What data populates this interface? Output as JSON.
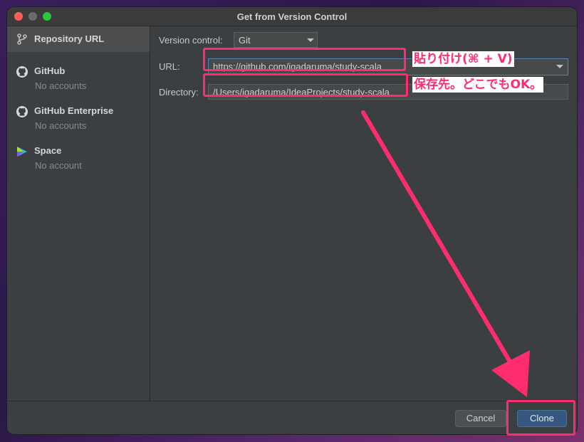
{
  "window": {
    "title": "Get from Version Control"
  },
  "sidebar": {
    "items": [
      {
        "label": "Repository URL",
        "icon": "vcs-branch-icon"
      },
      {
        "label": "GitHub",
        "sub": "No accounts",
        "icon": "github-icon"
      },
      {
        "label": "GitHub Enterprise",
        "sub": "No accounts",
        "icon": "github-icon"
      },
      {
        "label": "Space",
        "sub": "No account",
        "icon": "space-icon"
      }
    ]
  },
  "form": {
    "version_control_label": "Version control:",
    "version_control_value": "Git",
    "url_label": "URL:",
    "url_value": "https://github.com/igadaruma/study-scala",
    "directory_label": "Directory:",
    "directory_value": "/Users/igadaruma/IdeaProjects/study-scala"
  },
  "annotations": {
    "url_note": "貼り付け(⌘ + V)",
    "directory_note": "保存先。どこでもOK。"
  },
  "buttons": {
    "cancel": "Cancel",
    "clone": "Clone"
  },
  "colors": {
    "highlight": "#ff2d6f",
    "accent_button": "#365880",
    "panel": "#3c3f41"
  }
}
